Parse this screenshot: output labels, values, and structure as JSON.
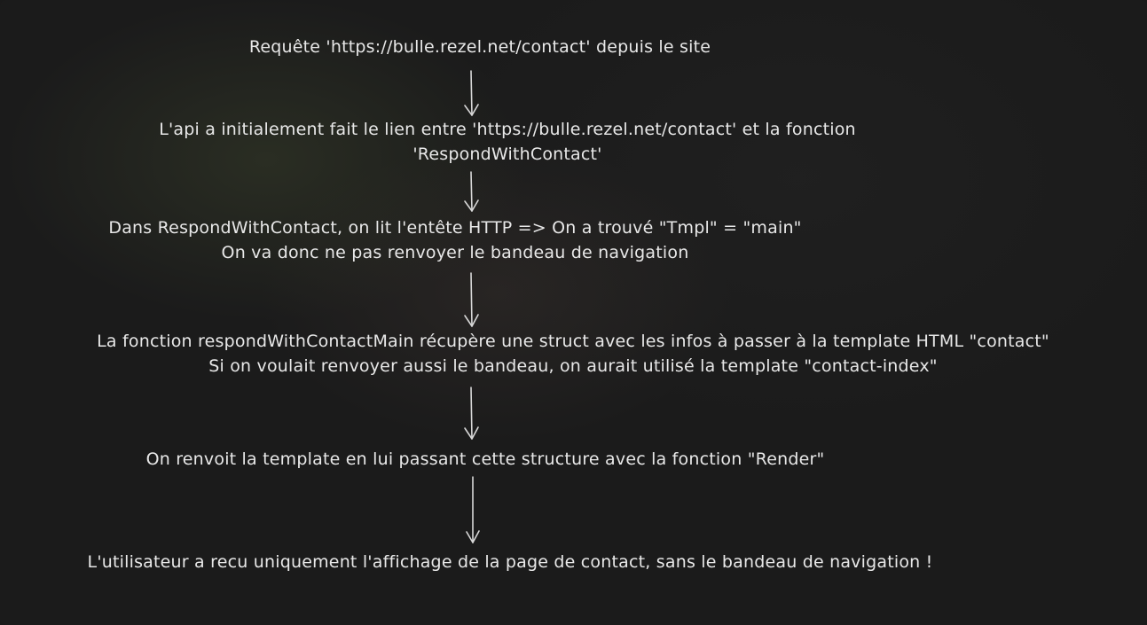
{
  "diagram": {
    "steps": [
      {
        "lines": [
          "Requête 'https://bulle.rezel.net/contact' depuis le site"
        ]
      },
      {
        "lines": [
          "L'api a initialement fait le lien entre 'https://bulle.rezel.net/contact' et la fonction",
          "'RespondWithContact'"
        ]
      },
      {
        "lines": [
          "Dans RespondWithContact, on lit l'entête HTTP => On a trouvé \"Tmpl\" = \"main\"",
          "On va donc ne pas renvoyer le bandeau de navigation"
        ]
      },
      {
        "lines": [
          "La fonction respondWithContactMain récupère une struct avec les infos à passer à la template HTML \"contact\"",
          "Si on voulait renvoyer aussi le bandeau, on aurait utilisé la template \"contact-index\""
        ]
      },
      {
        "lines": [
          "On renvoit la template en lui passant cette structure avec la fonction \"Render\""
        ]
      },
      {
        "lines": [
          "L'utilisateur a recu uniquement l'affichage de la page de contact, sans le bandeau de navigation !"
        ]
      }
    ],
    "colors": {
      "background": "#1b1b1b",
      "text": "#e8e8e8",
      "arrow": "#d8d8d8"
    }
  }
}
